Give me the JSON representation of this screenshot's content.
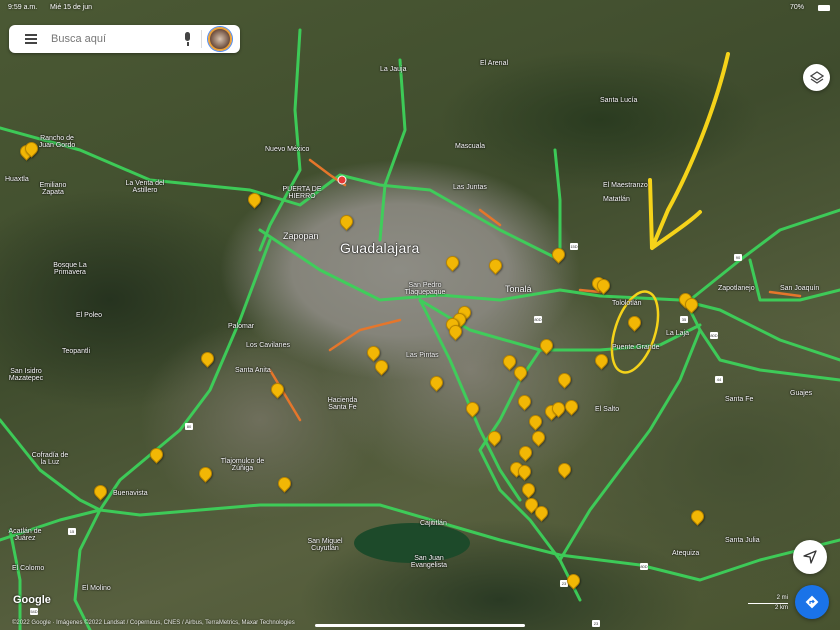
{
  "status_bar": {
    "time": "9:59 a.m.",
    "date": "Mié 15 de jun",
    "battery": "70%"
  },
  "search": {
    "placeholder": "Busca aquí"
  },
  "map": {
    "type": "satellite",
    "labels": {
      "guadalajara": "Guadalajara",
      "zapopan": "Zapopan",
      "tonala": "Tonalá",
      "tlaquepaque": "San Pedro Tlaquepaque",
      "puerta_hierro": "PUERTA DE HIERRO",
      "las_juntas": "Las Juntas",
      "mascuala": "Mascuala",
      "santa_anita": "Santa Anita",
      "los_cavilanes": "Los Cavilanes",
      "palomar": "Palomar",
      "las_pintas": "Las Pintas",
      "hacienda_santa_fe": "Hacienda Santa Fe",
      "el_salto": "El Salto",
      "tlajomulco": "Tlajomulco de Zúñiga",
      "buenavista": "Buenavista",
      "cajititlan": "Cajititlán",
      "san_miguel": "San Miguel Cuyutlán",
      "san_juan": "San Juan Evangelista",
      "santa_fe": "Santa Fe",
      "zapotlanejo": "Zapotlanejo",
      "san_joaquin": "San Joaquín",
      "puente_grande": "Puente Grande",
      "tololotlan": "Tololotlán",
      "atequiza": "Atequiza",
      "santa_julia": "Santa Julia",
      "cofradia": "Cofradía de la Luz",
      "acatlan": "Acatlán de Juárez",
      "el_colomo": "El Colomo",
      "el_molino": "El Molino",
      "san_isidro": "San Isidro Mazatepec",
      "el_poleo": "El Poleo",
      "bosque": "Bosque La Primavera",
      "emiliano_zapata": "Emiliano Zapata",
      "venta_astillero": "La Venta del Astillero",
      "matatlan": "Matatlán",
      "el_maestranzo": "El Maestranzo",
      "la_laja": "La Laja",
      "huaxtla": "Huaxtla",
      "rancho_gordo": "Rancho de Juan Gordo",
      "teopantli": "Teopantli",
      "santa_lucia": "Santa Lucía",
      "la_jauja": "La Jauja",
      "guajes": "Guajes",
      "el_arenal": "El Arenal",
      "nuevo_mexico": "Nuevo México"
    },
    "shields": [
      "80D",
      "80D",
      "15",
      "54D",
      "23",
      "80",
      "15D",
      "90",
      "44",
      "35",
      "80D",
      "23"
    ],
    "colors": {
      "traffic_green": "#3dd15a",
      "traffic_orange": "#e5762b",
      "pin": "#f2b705",
      "annotation": "#f5d31a"
    }
  },
  "scale": {
    "miles": "2 mi",
    "km": "2 km"
  },
  "branding": {
    "logo": "Google"
  },
  "attribution": "©2022 Google · Imágenes ©2022 Landsat / Copernicus, CNES / Airbus, TerraMetrics, Maxar Technologies"
}
